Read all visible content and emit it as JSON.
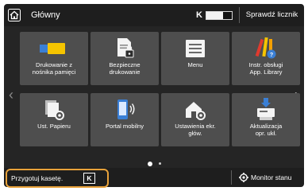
{
  "header": {
    "title": "Główny",
    "toner_letter": "K",
    "toner_level": 0.65,
    "counter_button": "Sprawdź licznik"
  },
  "tiles": [
    {
      "label": "Drukowanie z\nnośnika pamięci",
      "icon": "usb-memory-icon"
    },
    {
      "label": "Bezpieczne\ndrukowanie",
      "icon": "secure-print-icon"
    },
    {
      "label": "Menu",
      "icon": "menu-icon"
    },
    {
      "label": "Instr. obsługi\nApp. Library",
      "icon": "app-library-icon"
    },
    {
      "label": "Ust. Papieru",
      "icon": "paper-settings-icon"
    },
    {
      "label": "Portal mobilny",
      "icon": "mobile-portal-icon"
    },
    {
      "label": "Ustawienia ekr.\ngłów.",
      "icon": "home-screen-settings-icon"
    },
    {
      "label": "Aktualizacja\nopr. ukł.",
      "icon": "firmware-update-icon"
    }
  ],
  "pagination": {
    "pages": 2,
    "current": 1
  },
  "status_bar": {
    "message": "Przygotuj kasetę.",
    "message_letter": "K",
    "monitor_button": "Monitor stanu"
  },
  "colors": {
    "header_bg": "#1e1e1e",
    "body_bg": "#252525",
    "tile_bg": "#4e4e4e",
    "highlight": "#e8a23a",
    "accent_yellow": "#f5c400",
    "accent_blue": "#3a7fd5"
  }
}
